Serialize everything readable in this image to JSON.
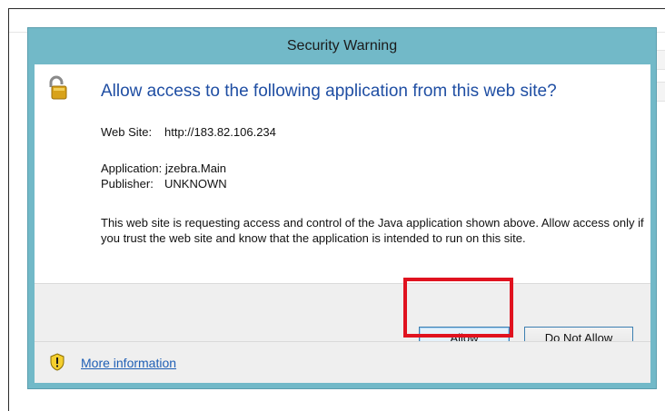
{
  "dialog": {
    "title": "Security Warning",
    "heading": "Allow access to the following application from this web site?",
    "website_label": "Web Site:",
    "website_value": "http://183.82.106.234",
    "application_label": "Application:",
    "application_value": "jzebra.Main",
    "publisher_label": "Publisher:",
    "publisher_value": "UNKNOWN",
    "message": "This web site is requesting access and control of the Java application shown above. Allow access only if you trust the web site and know that the application is intended to run on this site.",
    "allow_button": "Allow",
    "deny_button": "Do Not Allow",
    "more_info_link": "More information"
  },
  "colors": {
    "frame": "#72b9c8",
    "heading": "#1f4ea3",
    "highlight": "#e0121f",
    "link": "#1f5fb5"
  },
  "icons": [
    "lock-icon",
    "shield-warning-icon"
  ]
}
